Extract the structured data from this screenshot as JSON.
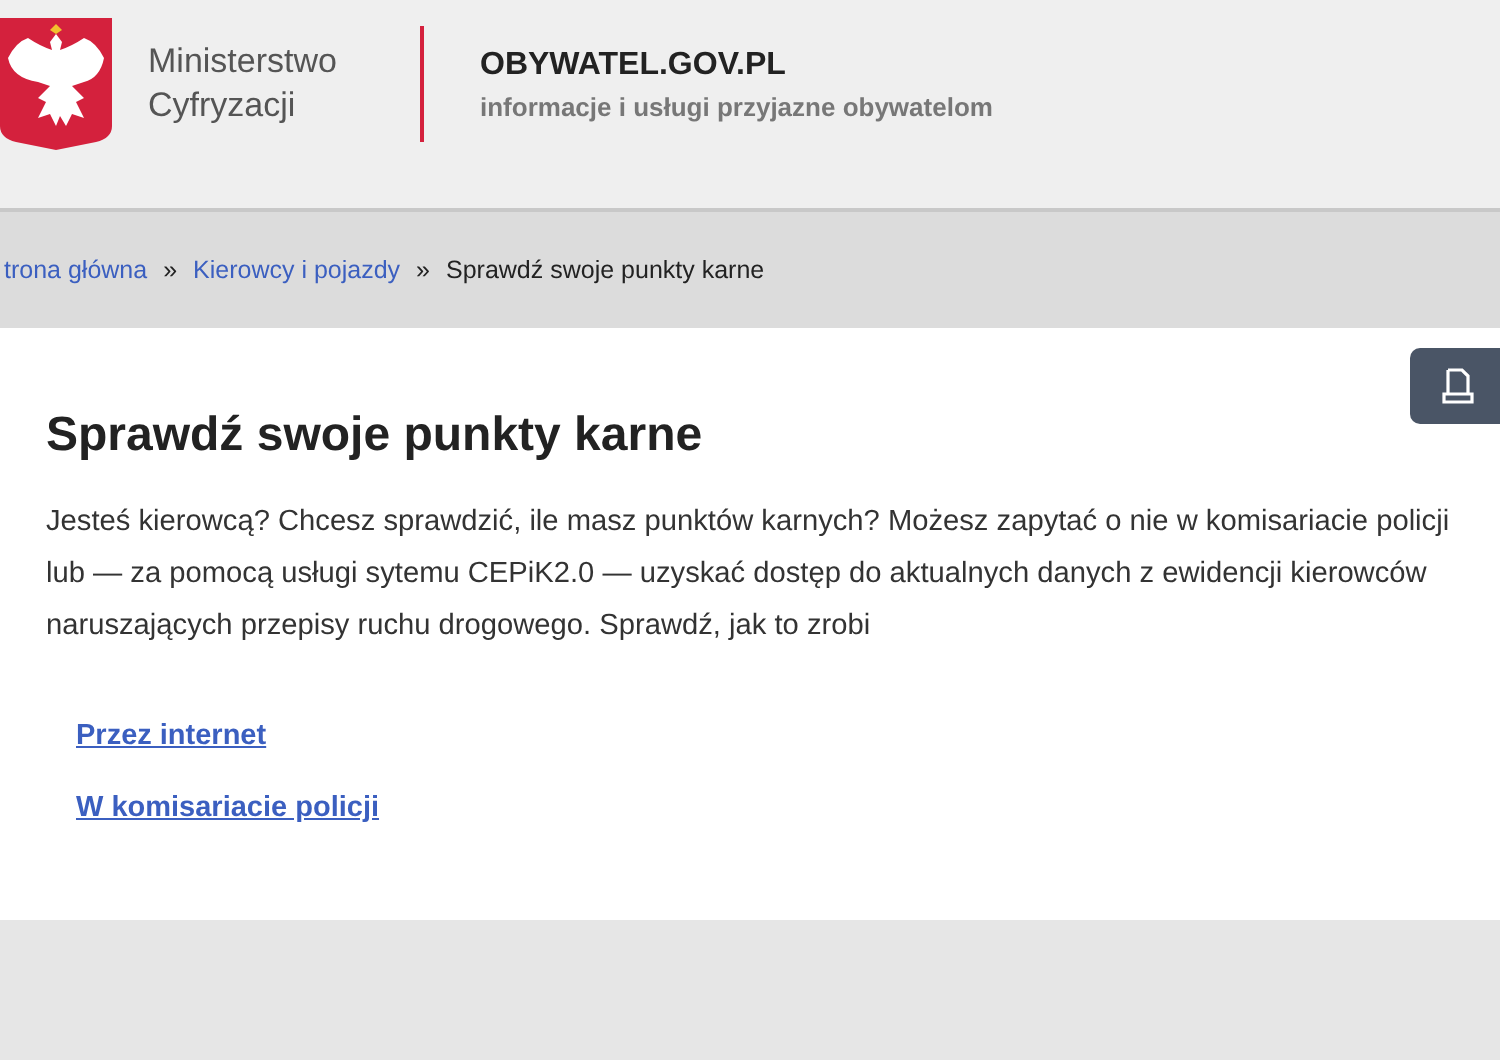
{
  "header": {
    "ministry_name": "Ministerstwo\nCyfryzacji",
    "site_title": "OBYWATEL.GOV.PL",
    "site_tagline": "informacje i usługi przyjazne obywatelom"
  },
  "breadcrumbs": {
    "items": [
      {
        "label": "trona główna",
        "kind": "link"
      },
      {
        "label": "Kierowcy i pojazdy",
        "kind": "link"
      },
      {
        "label": "Sprawdź swoje punkty karne",
        "kind": "current"
      }
    ],
    "separator": "»"
  },
  "page": {
    "title": "Sprawdź swoje punkty karne",
    "intro": "Jesteś kierowcą? Chcesz sprawdzić, ile masz punktów karnych? Możesz zapytać o nie w komisariacie policji lub — za pomocą usługi sytemu CEPiK2.0 — uzyskać dostęp do aktualnych danych z ewidencji kierowców naruszających przepisy ruchu drogowego. Sprawdź, jak to zrobi",
    "links": [
      "Przez internet",
      "W komisariacie policji"
    ]
  }
}
